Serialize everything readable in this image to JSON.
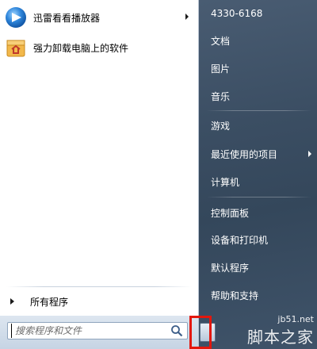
{
  "start_menu": {
    "programs": [
      {
        "label": "迅雷看看播放器",
        "icon": "xunlei-player-icon",
        "has_submenu": true
      },
      {
        "label": "强力卸载电脑上的软件",
        "icon": "uninstall-box-icon",
        "has_submenu": false
      }
    ],
    "all_programs_label": "所有程序",
    "search": {
      "placeholder": "搜索程序和文件",
      "value": ""
    },
    "right_items": [
      {
        "label": "4330-6168",
        "has_submenu": false
      },
      {
        "label": "文档",
        "has_submenu": false
      },
      {
        "label": "图片",
        "has_submenu": false
      },
      {
        "label": "音乐",
        "has_submenu": false
      },
      {
        "label": "游戏",
        "has_submenu": false
      },
      {
        "label": "最近使用的项目",
        "has_submenu": true
      },
      {
        "label": "计算机",
        "has_submenu": false
      },
      {
        "label": "控制面板",
        "has_submenu": false
      },
      {
        "label": "设备和打印机",
        "has_submenu": false
      },
      {
        "label": "默认程序",
        "has_submenu": false
      },
      {
        "label": "帮助和支持",
        "has_submenu": false
      }
    ]
  },
  "watermark": {
    "url": "jb51.net",
    "text": "脚本之家"
  },
  "colors": {
    "right_pane": "#3b4e63",
    "highlight": "#e3170d"
  }
}
